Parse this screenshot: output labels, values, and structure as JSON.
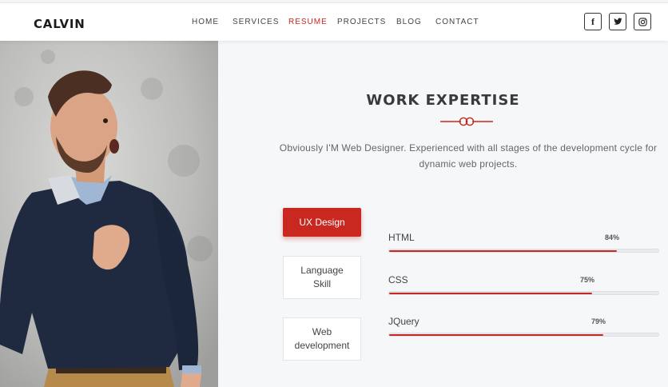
{
  "brand": {
    "logo": "CALVIN"
  },
  "nav": {
    "items": [
      {
        "label": "HOME",
        "active": false
      },
      {
        "label": "SERVICES",
        "active": false
      },
      {
        "label": "RESUME",
        "active": true
      },
      {
        "label": "PROJECTS",
        "active": false
      },
      {
        "label": "BLOG",
        "active": false
      },
      {
        "label": "CONTACT",
        "active": false
      }
    ]
  },
  "social": [
    {
      "icon": "facebook-icon",
      "glyph": "f"
    },
    {
      "icon": "twitter-icon"
    },
    {
      "icon": "instagram-icon"
    }
  ],
  "section": {
    "title": "WORK EXPERTISE",
    "description": "Obviously I'M Web Designer. Experienced with all stages of the development cycle for dynamic web projects."
  },
  "tabs": [
    {
      "label": "UX Design",
      "active": true
    },
    {
      "label": "Language Skill",
      "active": false
    },
    {
      "label": "Web development",
      "active": false
    }
  ],
  "skills": [
    {
      "name": "HTML",
      "percent_label": "84%",
      "value": 0.84
    },
    {
      "name": "CSS",
      "percent_label": "75%",
      "value": 0.75
    },
    {
      "name": "JQuery",
      "percent_label": "79%",
      "value": 0.79
    }
  ],
  "colors": {
    "accent": "#c8281f",
    "panel_bg": "#f6f7f9",
    "heading": "#3a3a3a"
  }
}
